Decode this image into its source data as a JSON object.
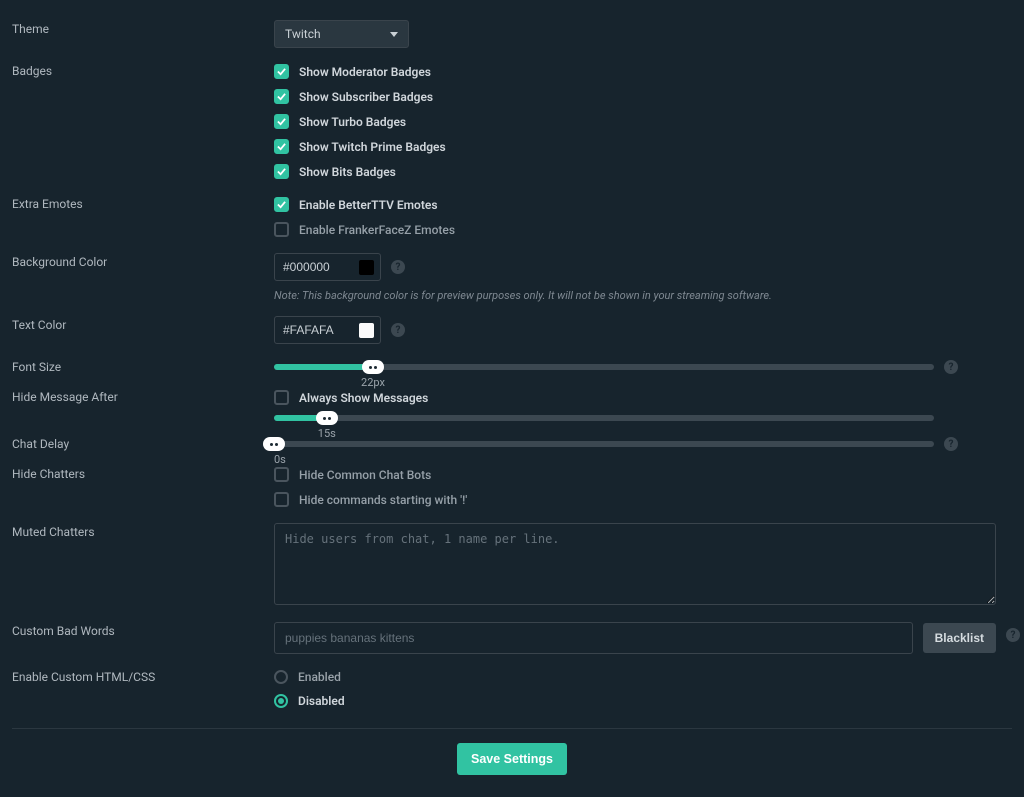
{
  "theme": {
    "label": "Theme",
    "selected": "Twitch"
  },
  "badges": {
    "label": "Badges",
    "items": [
      {
        "label": "Show Moderator Badges",
        "checked": true
      },
      {
        "label": "Show Subscriber Badges",
        "checked": true
      },
      {
        "label": "Show Turbo Badges",
        "checked": true
      },
      {
        "label": "Show Twitch Prime Badges",
        "checked": true
      },
      {
        "label": "Show Bits Badges",
        "checked": true
      }
    ]
  },
  "extra_emotes": {
    "label": "Extra Emotes",
    "items": [
      {
        "label": "Enable BetterTTV Emotes",
        "checked": true
      },
      {
        "label": "Enable FrankerFaceZ Emotes",
        "checked": false
      }
    ]
  },
  "bg_color": {
    "label": "Background Color",
    "value": "#000000",
    "note": "Note: This background color is for preview purposes only. It will not be shown in your streaming software."
  },
  "text_color": {
    "label": "Text Color",
    "value": "#FAFAFA"
  },
  "font_size": {
    "label": "Font Size",
    "value": "22px",
    "percent": 15
  },
  "hide_after": {
    "label": "Hide Message After",
    "always_label": "Always Show Messages",
    "always_checked": false,
    "value": "15s",
    "percent": 8
  },
  "chat_delay": {
    "label": "Chat Delay",
    "value": "0s",
    "percent": 0
  },
  "hide_chatters": {
    "label": "Hide Chatters",
    "items": [
      {
        "label": "Hide Common Chat Bots",
        "checked": false
      },
      {
        "label": "Hide commands starting with '!'",
        "checked": false
      }
    ]
  },
  "muted": {
    "label": "Muted Chatters",
    "placeholder": "Hide users from chat, 1 name per line."
  },
  "bad_words": {
    "label": "Custom Bad Words",
    "placeholder": "puppies bananas kittens",
    "button": "Blacklist"
  },
  "custom_html": {
    "label": "Enable Custom HTML/CSS",
    "enabled_label": "Enabled",
    "disabled_label": "Disabled",
    "selected": "disabled"
  },
  "save_label": "Save Settings",
  "help_glyph": "?"
}
